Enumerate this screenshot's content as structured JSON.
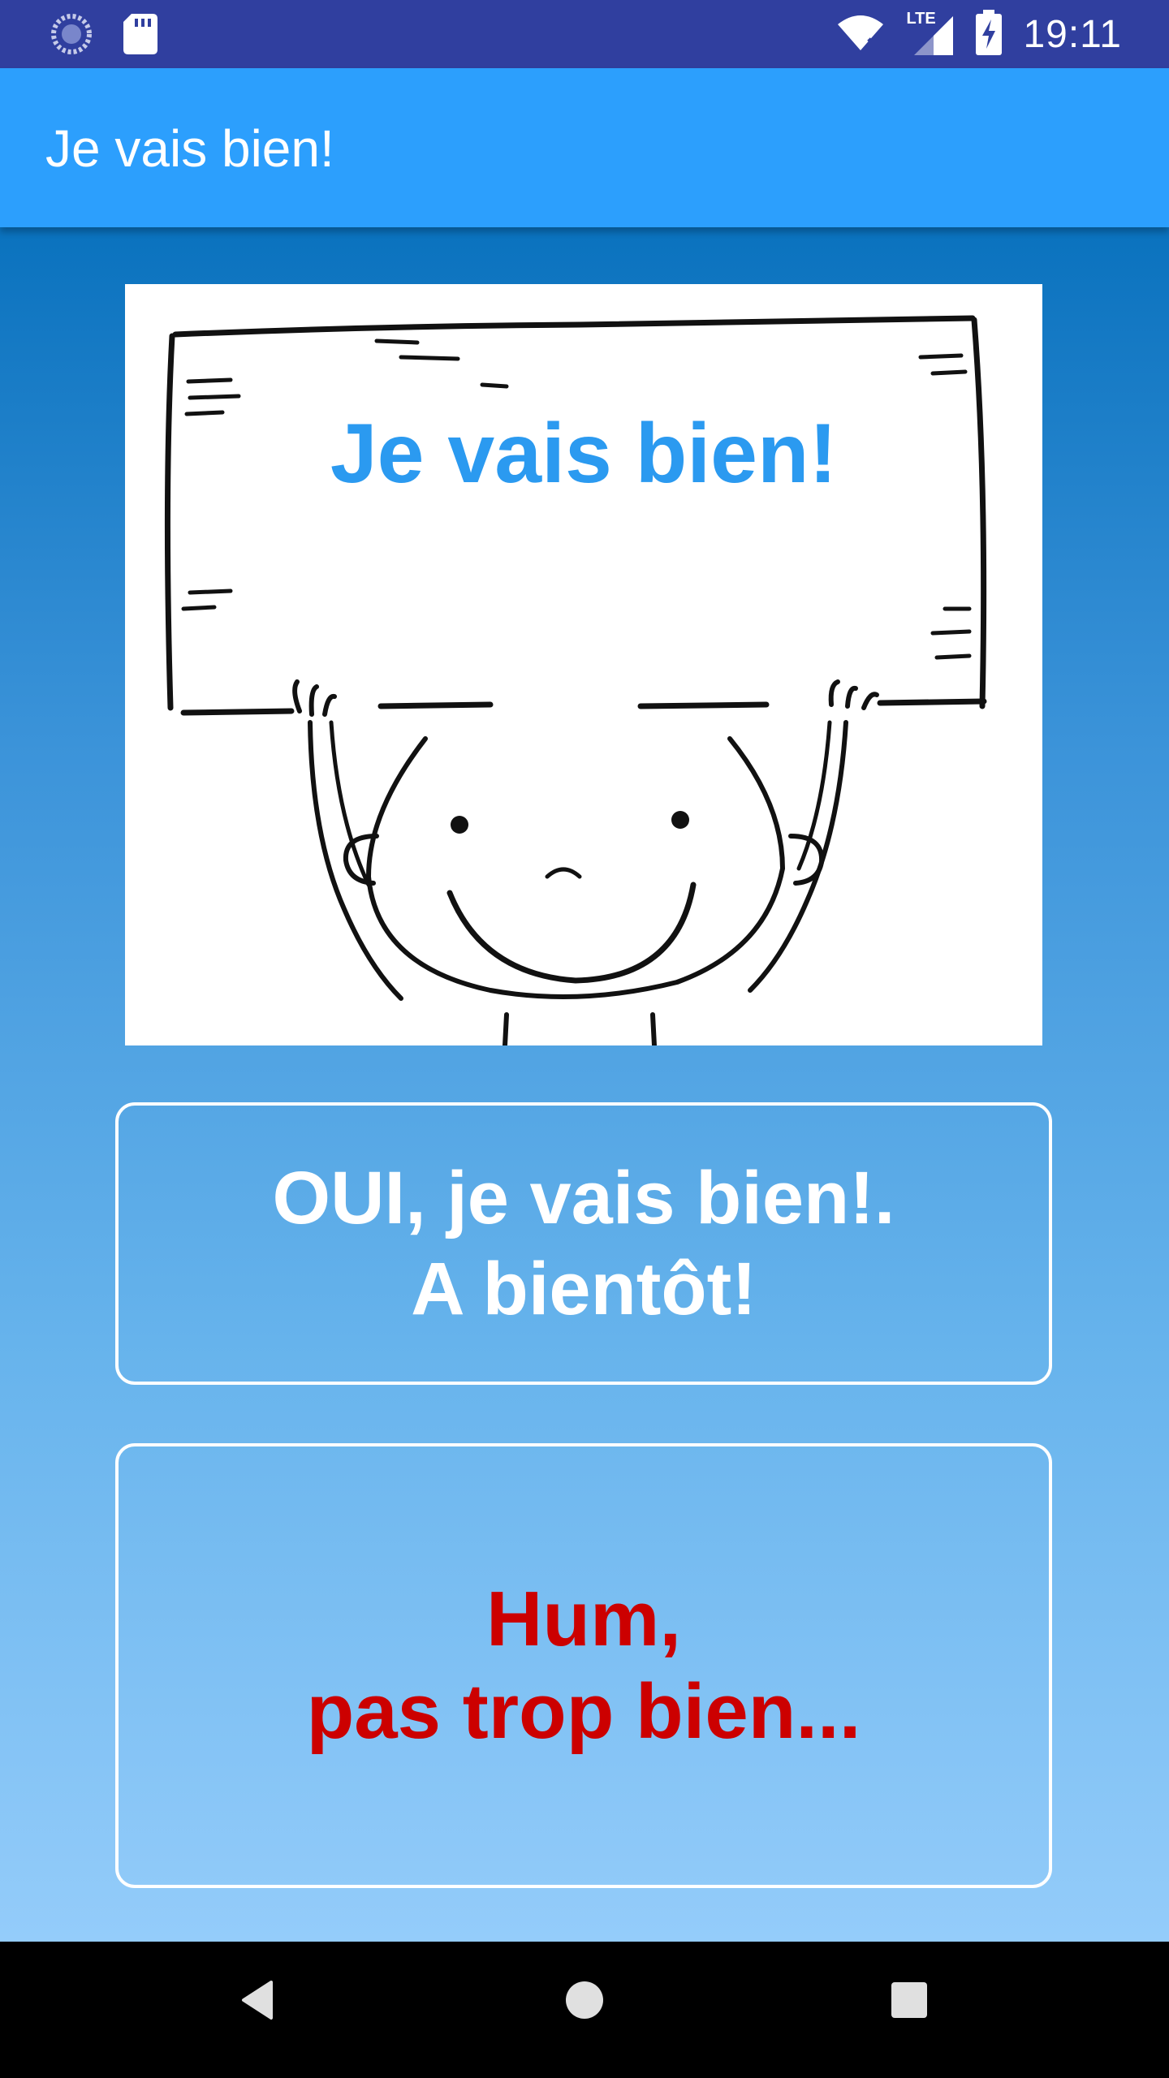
{
  "status_bar": {
    "time": "19:11",
    "network_label": "LTE",
    "icons": [
      "sync-icon",
      "sd-card-icon",
      "wifi-icon",
      "signal-icon",
      "battery-charging-icon"
    ]
  },
  "app_bar": {
    "title": "Je vais bien!"
  },
  "image": {
    "sign_text": "Je vais bien!",
    "sign_text_color": "#2b9af0"
  },
  "buttons": {
    "yes_label": "OUI, je vais bien!.\nA bientôt!",
    "no_label": "Hum,\npas trop bien..."
  },
  "colors": {
    "status_bar": "#303f9f",
    "app_bar": "#2c9ffd",
    "yes_text": "#ffffff",
    "no_text": "#cc0000"
  },
  "nav_bar": {
    "icons": [
      "back-icon",
      "home-icon",
      "recents-icon"
    ]
  }
}
